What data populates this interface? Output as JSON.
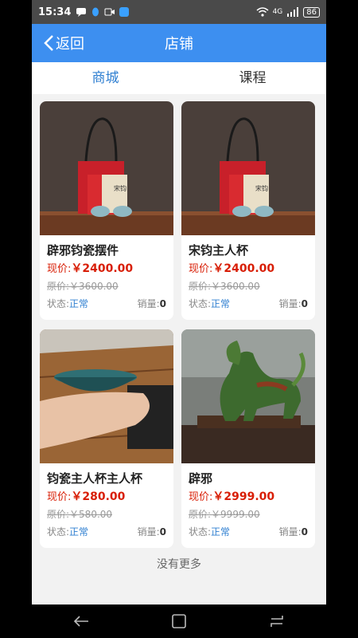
{
  "status": {
    "time": "15:34",
    "battery": "86",
    "network": "4G"
  },
  "header": {
    "back_label": "返回",
    "title": "店铺"
  },
  "tabs": [
    {
      "label": "商城",
      "active": true
    },
    {
      "label": "课程",
      "active": false
    }
  ],
  "labels": {
    "price_prefix": "现价:",
    "orig_prefix": "原价:",
    "status_prefix": "状态:",
    "sales_prefix": "销量:"
  },
  "products": [
    {
      "name": "辟邪钧瓷摆件",
      "price": "￥2400.00",
      "orig_price": "￥3600.00",
      "status": "正常",
      "sales": "0",
      "image": "gift-box-teacups"
    },
    {
      "name": "宋钧主人杯",
      "price": "￥2400.00",
      "orig_price": "￥3600.00",
      "status": "正常",
      "sales": "0",
      "image": "gift-box-teacups"
    },
    {
      "name": "钧瓷主人杯主人杯",
      "price": "￥280.00",
      "orig_price": "￥580.00",
      "status": "正常",
      "sales": "0",
      "image": "bowl-in-hand"
    },
    {
      "name": "辟邪",
      "price": "￥2999.00",
      "orig_price": "￥9999.00",
      "status": "正常",
      "sales": "0",
      "image": "pixiu-statue"
    }
  ],
  "footer": {
    "no_more": "没有更多"
  },
  "colors": {
    "header": "#3d8ff0",
    "tab_active": "#2f7fd1",
    "price": "#d81e06"
  }
}
